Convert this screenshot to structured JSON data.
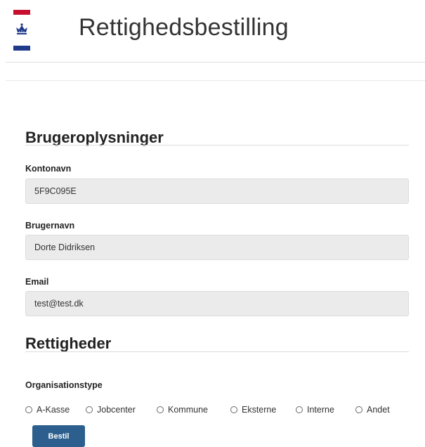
{
  "header": {
    "title": "Rettighedsbestilling",
    "logo_icon": "crown-icon",
    "colors": {
      "flag_red": "#c8102e",
      "flag_blue": "#1f3b8a"
    }
  },
  "user_info": {
    "heading": "Brugeroplysninger",
    "fields": [
      {
        "label": "Kontonavn",
        "value": "5F9C095E"
      },
      {
        "label": "Brugernavn",
        "value": "Dorte Didriksen"
      },
      {
        "label": "Email",
        "value": "test@test.dk"
      }
    ]
  },
  "rights": {
    "heading": "Rettigheder",
    "org_type_label": "Organisationstype",
    "options": [
      "A-Kasse",
      "Jobcenter",
      "Kommune",
      "Eksterne",
      "Interne",
      "Andet"
    ]
  },
  "actions": {
    "submit_label": "Bestil",
    "button_color": "#2c5f8d"
  }
}
